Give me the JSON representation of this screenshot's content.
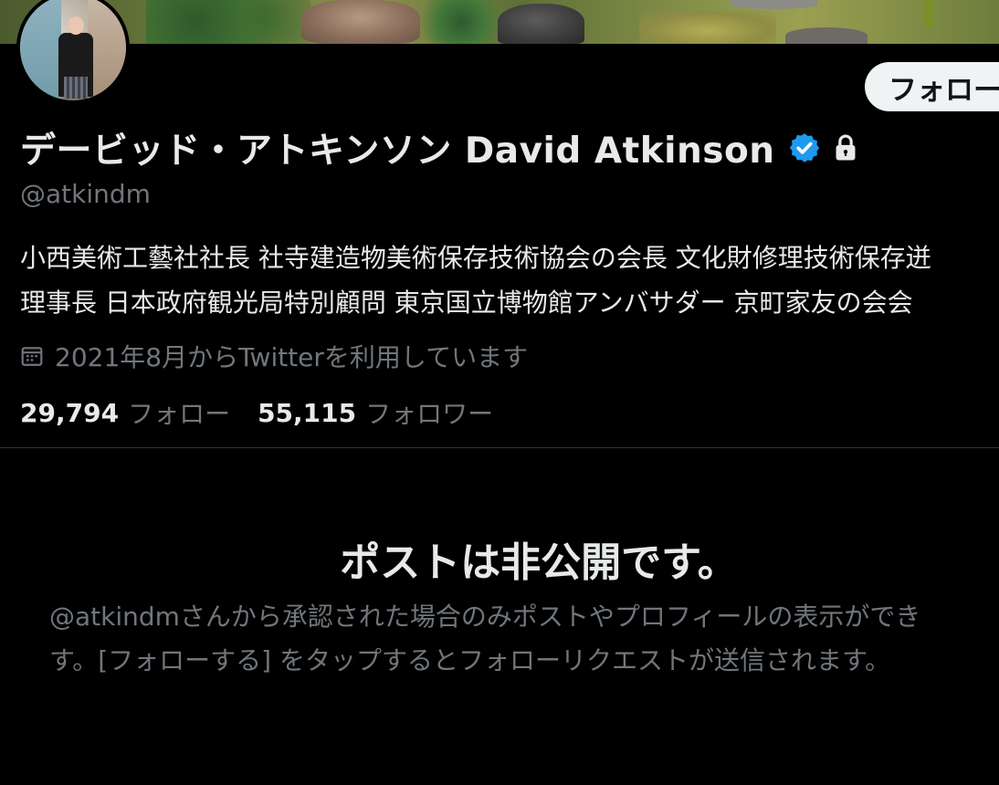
{
  "profile": {
    "display_name": "デービッド・アトキンソン David Atkinson",
    "handle": "@atkindm",
    "verified": true,
    "protected": true,
    "bio_lines": [
      "小西美術工藝社社長 社寺建造物美術保存技術協会の会長 文化財修理技術保存迸",
      "理事長 日本政府観光局特別顧問 東京国立博物館アンバサダー 京町家友の会会"
    ],
    "joined": "2021年8月からTwitterを利用しています",
    "following_count": "29,794",
    "following_label": "フォロー",
    "followers_count": "55,115",
    "followers_label": "フォロワー"
  },
  "actions": {
    "follow_label": "フォロー"
  },
  "private_notice": {
    "title": "ポストは非公開です。",
    "description_lines": [
      "@atkindmさんから承認された場合のみポストやプロフィールの表示ができ",
      "す。[フォローする] をタップするとフォローリクエストが送信されます。"
    ]
  },
  "colors": {
    "background": "#000000",
    "text_primary": "#e7e9ea",
    "text_secondary": "#71767b",
    "verified_blue": "#1d9bf0",
    "button_bg": "#eff3f4",
    "divider": "#2f3336"
  },
  "icons": {
    "verified": "verified-badge-icon",
    "lock": "lock-icon",
    "calendar": "calendar-icon"
  }
}
